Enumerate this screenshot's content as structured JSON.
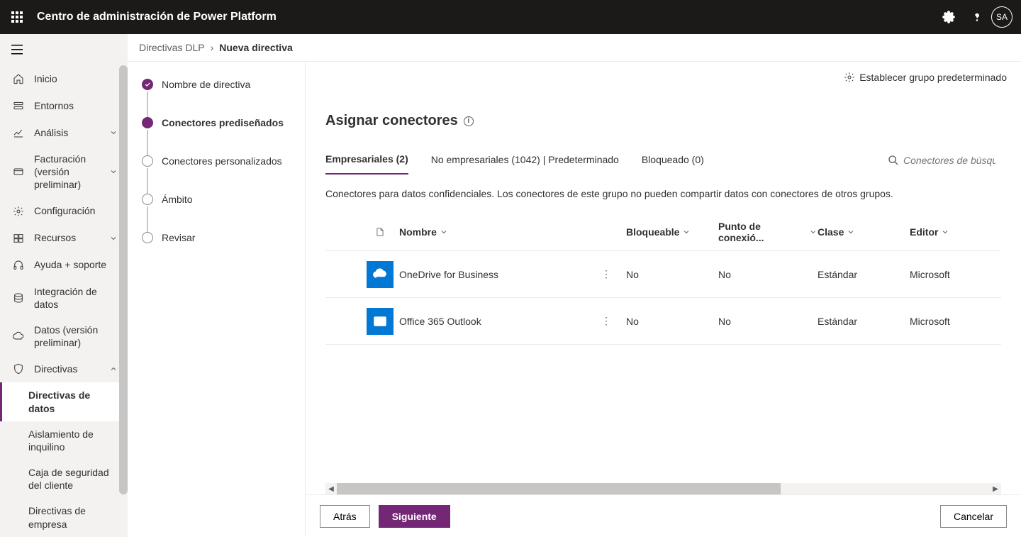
{
  "topbar": {
    "title": "Centro de administración de Power Platform",
    "avatar": "SA"
  },
  "sidebar": {
    "items": [
      {
        "icon": "home",
        "label": "Inicio"
      },
      {
        "icon": "env",
        "label": "Entornos"
      },
      {
        "icon": "chart",
        "label": "Análisis",
        "chevron": "down"
      },
      {
        "icon": "billing",
        "label": "Facturación (versión preliminar)",
        "chevron": "down"
      },
      {
        "icon": "gear",
        "label": "Configuración"
      },
      {
        "icon": "res",
        "label": "Recursos",
        "chevron": "down"
      },
      {
        "icon": "help",
        "label": "Ayuda + soporte"
      },
      {
        "icon": "data",
        "label": "Integración de datos"
      },
      {
        "icon": "cloud",
        "label": "Datos (versión preliminar)"
      },
      {
        "icon": "shield",
        "label": "Directivas",
        "chevron": "up"
      }
    ],
    "subitems": [
      {
        "label": "Directivas de datos",
        "active": true
      },
      {
        "label": "Aislamiento de inquilino"
      },
      {
        "label": "Caja de seguridad del cliente"
      },
      {
        "label": "Directivas de empresa"
      }
    ]
  },
  "breadcrumb": {
    "parent": "Directivas DLP",
    "current": "Nueva directiva"
  },
  "steps": [
    {
      "label": "Nombre de directiva",
      "state": "done"
    },
    {
      "label": "Conectores prediseñados",
      "state": "active"
    },
    {
      "label": "Conectores personalizados",
      "state": "pending"
    },
    {
      "label": "Ámbito",
      "state": "pending"
    },
    {
      "label": "Revisar",
      "state": "pending"
    }
  ],
  "toolbar": {
    "set_default": "Establecer grupo predeterminado"
  },
  "page": {
    "title": "Asignar conectores",
    "tabs": [
      {
        "label": "Empresariales (2)",
        "active": true
      },
      {
        "label": "No empresariales (1042) | Predeterminado"
      },
      {
        "label": "Bloqueado (0)"
      }
    ],
    "search_placeholder": "Conectores de búsqu...",
    "tab_desc": "Conectores para datos confidenciales. Los conectores de este grupo no pueden compartir datos con conectores de otros grupos.",
    "columns": {
      "name": "Nombre",
      "blockable": "Bloqueable",
      "endpoint": "Punto de conexió...",
      "class": "Clase",
      "editor": "Editor"
    },
    "rows": [
      {
        "icon": "onedrive",
        "name": "OneDrive for Business",
        "blockable": "No",
        "endpoint": "No",
        "class": "Estándar",
        "editor": "Microsoft"
      },
      {
        "icon": "outlook",
        "name": "Office 365 Outlook",
        "blockable": "No",
        "endpoint": "No",
        "class": "Estándar",
        "editor": "Microsoft"
      }
    ]
  },
  "footer": {
    "back": "Atrás",
    "next": "Siguiente",
    "cancel": "Cancelar"
  }
}
